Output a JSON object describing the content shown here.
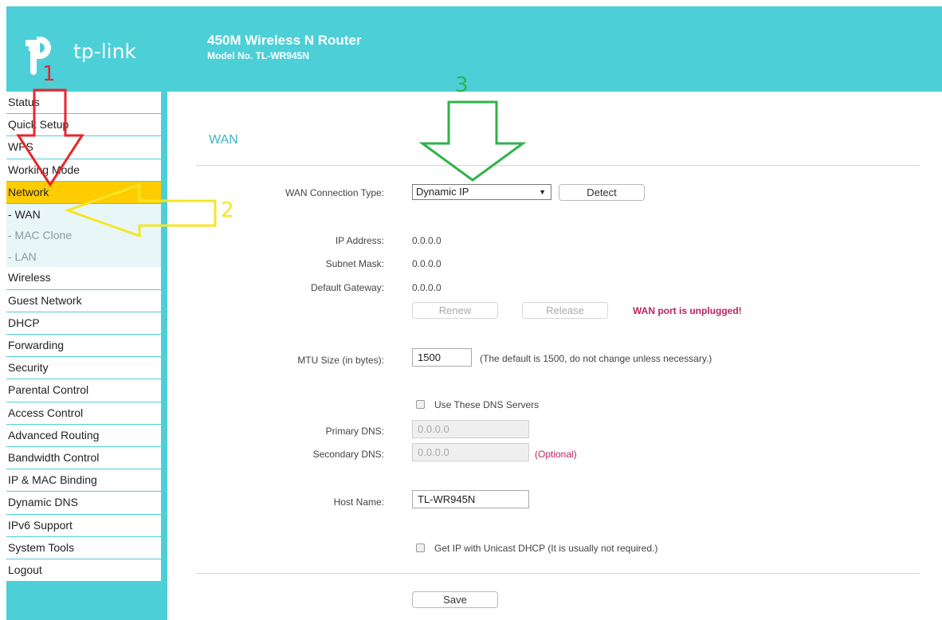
{
  "header": {
    "logo_text": "tp-link",
    "title": "450M Wireless N Router",
    "model": "Model No. TL-WR945N"
  },
  "sidebar": {
    "items": [
      {
        "label": "Status"
      },
      {
        "label": "Quick Setup"
      },
      {
        "label": "WPS"
      },
      {
        "label": "Working Mode"
      },
      {
        "label": "Network",
        "active": true
      },
      {
        "label": "- WAN",
        "sub": true,
        "active": true
      },
      {
        "label": "- MAC Clone",
        "sub": true
      },
      {
        "label": "- LAN",
        "sub": true
      },
      {
        "label": "Wireless"
      },
      {
        "label": "Guest Network"
      },
      {
        "label": "DHCP"
      },
      {
        "label": "Forwarding"
      },
      {
        "label": "Security"
      },
      {
        "label": "Parental Control"
      },
      {
        "label": "Access Control"
      },
      {
        "label": "Advanced Routing"
      },
      {
        "label": "Bandwidth Control"
      },
      {
        "label": "IP & MAC Binding"
      },
      {
        "label": "Dynamic DNS"
      },
      {
        "label": "IPv6 Support"
      },
      {
        "label": "System Tools"
      },
      {
        "label": "Logout"
      }
    ]
  },
  "main": {
    "title": "WAN",
    "wan_type_label": "WAN Connection Type:",
    "wan_type_value": "Dynamic IP",
    "detect_label": "Detect",
    "ip_label": "IP Address:",
    "ip_value": "0.0.0.0",
    "subnet_label": "Subnet Mask:",
    "subnet_value": "0.0.0.0",
    "gateway_label": "Default Gateway:",
    "gateway_value": "0.0.0.0",
    "renew_label": "Renew",
    "release_label": "Release",
    "warning": "WAN port is unplugged!",
    "mtu_label": "MTU Size (in bytes):",
    "mtu_value": "1500",
    "mtu_hint": "(The default is 1500, do not change unless necessary.)",
    "use_dns_label": "Use These DNS Servers",
    "primary_dns_label": "Primary DNS:",
    "primary_dns_value": "0.0.0.0",
    "secondary_dns_label": "Secondary DNS:",
    "secondary_dns_value": "0.0.0.0",
    "optional_label": "(Optional)",
    "hostname_label": "Host Name:",
    "hostname_value": "TL-WR945N",
    "unicast_label": "Get IP with Unicast DHCP (It is usually not required.)",
    "save_label": "Save"
  },
  "annotations": {
    "num1": "1",
    "num2": "2",
    "num3": "3",
    "color1": "#e8262d",
    "color2": "#f5e623",
    "color3": "#2fb34a"
  },
  "colors": {
    "teal": "#4dcfd8",
    "active": "#ffcc00",
    "warning": "#b8255f"
  }
}
